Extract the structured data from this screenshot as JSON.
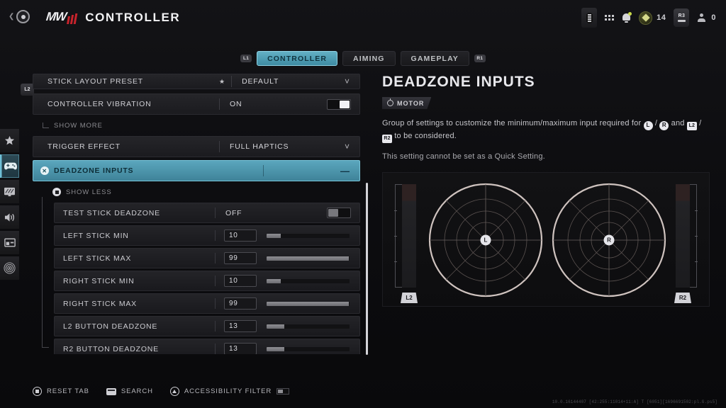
{
  "header": {
    "back_label": "back",
    "logo_text": "MWIII",
    "title": "CONTROLLER",
    "status": {
      "battery_icon": "battery-icon",
      "grid_icon": "grid-menu-icon",
      "bell_icon": "notifications-icon",
      "currency_icon": "cod-points-icon",
      "currency_value": "14",
      "r3_label": "R3",
      "party_icon": "party-icon",
      "party_value": "0"
    }
  },
  "tabs": {
    "left_bumper": "L1",
    "right_bumper": "R1",
    "items": [
      {
        "label": "CONTROLLER",
        "active": true
      },
      {
        "label": "AIMING",
        "active": false
      },
      {
        "label": "GAMEPLAY",
        "active": false
      }
    ]
  },
  "rail": {
    "badge": "L2",
    "items": [
      {
        "name": "favorites-icon",
        "label": "Favorites"
      },
      {
        "name": "controller-icon",
        "label": "Controller"
      },
      {
        "name": "graphics-icon",
        "label": "Graphics"
      },
      {
        "name": "audio-icon",
        "label": "Audio"
      },
      {
        "name": "interface-icon",
        "label": "Interface"
      },
      {
        "name": "accessibility-icon",
        "label": "Accessibility"
      }
    ]
  },
  "settings": {
    "rows": [
      {
        "label": "STICK LAYOUT PRESET",
        "value": "DEFAULT",
        "type": "dropdown",
        "starred": true,
        "clipped": true
      },
      {
        "label": "CONTROLLER VIBRATION",
        "value": "ON",
        "type": "toggle",
        "toggle": "on"
      },
      {
        "label": "TRIGGER EFFECT",
        "value": "FULL HAPTICS",
        "type": "dropdown"
      }
    ],
    "show_more_label": "SHOW MORE",
    "show_less_label": "SHOW LESS",
    "group": {
      "label": "DEADZONE INPUTS",
      "collapse_glyph": "—",
      "cancel_glyph": "✕"
    },
    "sub_rows": [
      {
        "label": "TEST STICK DEADZONE",
        "value": "OFF",
        "type": "toggle",
        "toggle": "off"
      },
      {
        "label": "LEFT STICK MIN",
        "value": "10",
        "type": "slider",
        "fill": 17
      },
      {
        "label": "LEFT STICK MAX",
        "value": "99",
        "type": "slider",
        "fill": 99
      },
      {
        "label": "RIGHT STICK MIN",
        "value": "10",
        "type": "slider",
        "fill": 17
      },
      {
        "label": "RIGHT STICK MAX",
        "value": "99",
        "type": "slider",
        "fill": 99
      },
      {
        "label": "L2 BUTTON DEADZONE",
        "value": "13",
        "type": "slider",
        "fill": 21
      },
      {
        "label": "R2 BUTTON DEADZONE",
        "value": "13",
        "type": "slider",
        "fill": 21
      }
    ]
  },
  "detail": {
    "title": "DEADZONE INPUTS",
    "badge": "MOTOR",
    "description_a": "Group of settings to customize the minimum/maximum input required for",
    "key_l": "L",
    "sep1": "/",
    "key_r": "R",
    "mid": "and",
    "key_l2": "L2",
    "sep2": "/",
    "key_r2": "R2",
    "description_b": "to be considered.",
    "note": "This setting cannot be set as a Quick Setting."
  },
  "visualizer": {
    "left_stick_label": "L",
    "right_stick_label": "R",
    "left_trigger_label": "L2",
    "right_trigger_label": "R2",
    "ticks": [
      "75",
      "50",
      "25"
    ]
  },
  "footer": {
    "reset_label": "RESET TAB",
    "search_label": "SEARCH",
    "accessibility_label": "ACCESSIBILITY FILTER",
    "build": "10.0.16144407 [42:255:11014+11:A] T [6051][1696691502:pl.G.ps5]"
  },
  "colors": {
    "accent": "#5ba6bd",
    "brand_red": "#c8232c",
    "panel_bg": "#121214"
  }
}
